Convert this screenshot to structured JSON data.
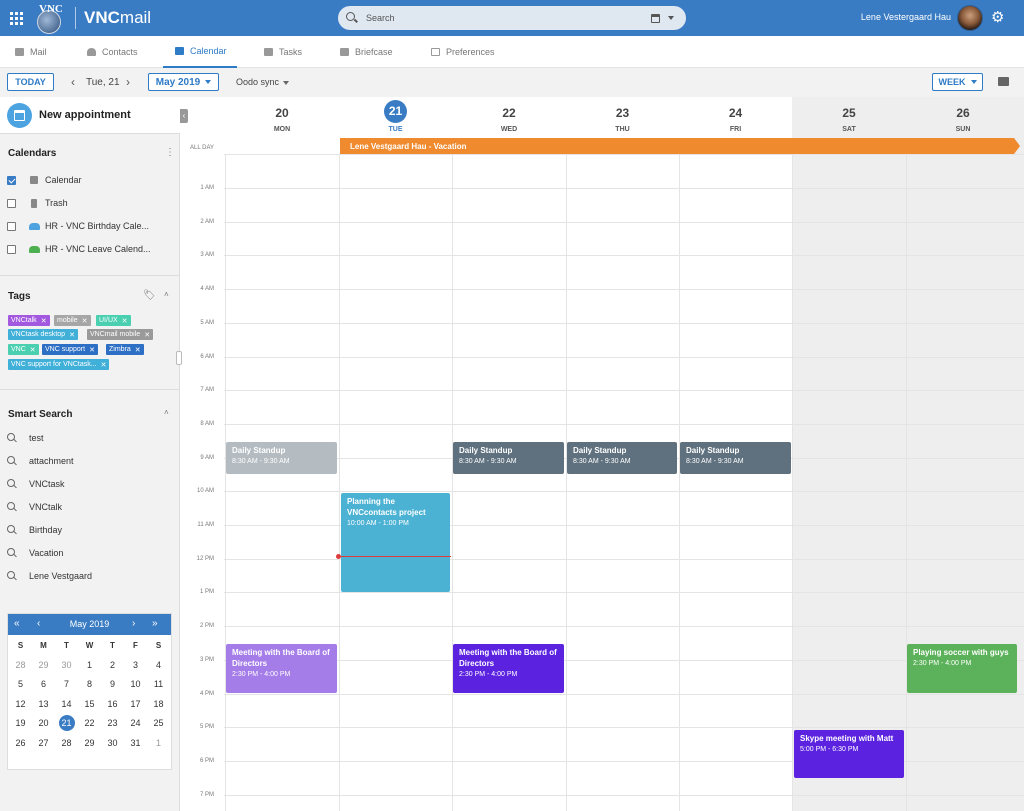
{
  "app": {
    "brand_prefix": "VNC",
    "brand_suffix": "mail",
    "logo_text": "VNC"
  },
  "search": {
    "placeholder": "Search"
  },
  "user": {
    "name": "Lene Vestergaard Hau"
  },
  "tabs": [
    {
      "label": "Mail"
    },
    {
      "label": "Contacts"
    },
    {
      "label": "Calendar",
      "active": true
    },
    {
      "label": "Tasks"
    },
    {
      "label": "Briefcase"
    },
    {
      "label": "Preferences"
    }
  ],
  "toolbar": {
    "today": "TODAY",
    "prev": "‹",
    "date": "Tue, 21",
    "next": "›",
    "month": "May 2019",
    "sync": "Oodo sync",
    "view": "WEEK"
  },
  "sidebar": {
    "new_appointment": "New appointment",
    "calendars_title": "Calendars",
    "calendars": [
      {
        "label": "Calendar",
        "checked": true
      },
      {
        "label": "Trash",
        "checked": false
      },
      {
        "label": "HR - VNC Birthday Cale...",
        "checked": false
      },
      {
        "label": "HR - VNC Leave Calend...",
        "checked": false
      }
    ],
    "tags_title": "Tags",
    "tags": [
      {
        "label": "VNCtalk",
        "color": "#a259e0"
      },
      {
        "label": "mobile",
        "color": "#a6a6a6"
      },
      {
        "label": "UI/UX",
        "color": "#4ad0b0"
      },
      {
        "label": "VNCtask desktop",
        "color": "#41b0d8"
      },
      {
        "label": "VNCmail mobile",
        "color": "#9a9a9a"
      },
      {
        "label": "VNC",
        "color": "#4ad0b0"
      },
      {
        "label": "VNC support",
        "color": "#2e6fc6"
      },
      {
        "label": "Zimbra",
        "color": "#2e6fc6"
      },
      {
        "label": "VNC support for VNCtask...",
        "color": "#41b0d8"
      }
    ],
    "smart_search_title": "Smart Search",
    "smart_searches": [
      "test",
      "attachment",
      "VNCtask",
      "VNCtalk",
      "Birthday",
      "Vacation",
      "Lene Vestgaard"
    ]
  },
  "minical": {
    "title": "May 2019",
    "weekdays": [
      "S",
      "M",
      "T",
      "W",
      "T",
      "F",
      "S"
    ],
    "weeks": [
      [
        "28",
        "29",
        "30",
        "1",
        "2",
        "3",
        "4"
      ],
      [
        "5",
        "6",
        "7",
        "8",
        "9",
        "10",
        "11"
      ],
      [
        "12",
        "13",
        "14",
        "15",
        "16",
        "17",
        "18"
      ],
      [
        "19",
        "20",
        "21",
        "22",
        "23",
        "24",
        "25"
      ],
      [
        "26",
        "27",
        "28",
        "29",
        "30",
        "31",
        "1"
      ]
    ],
    "selected": "21"
  },
  "week": {
    "days": [
      {
        "num": "20",
        "dow": "MON"
      },
      {
        "num": "21",
        "dow": "TUE",
        "today": true
      },
      {
        "num": "22",
        "dow": "WED"
      },
      {
        "num": "23",
        "dow": "THU"
      },
      {
        "num": "24",
        "dow": "FRI"
      },
      {
        "num": "25",
        "dow": "SAT",
        "weekend": true
      },
      {
        "num": "26",
        "dow": "SUN",
        "weekend": true
      }
    ],
    "all_day_label": "ALL DAY",
    "all_day_event": "Lene Vestgaard Hau - Vacation",
    "hours": [
      "1 AM",
      "2 AM",
      "3 AM",
      "4 AM",
      "5 AM",
      "6 AM",
      "7 AM",
      "8 AM",
      "9 AM",
      "10 AM",
      "11 AM",
      "12 PM",
      "1 PM",
      "2 PM",
      "3 PM",
      "4 PM",
      "5 PM",
      "6 PM",
      "7 PM"
    ],
    "events": [
      {
        "title": "Daily Standup",
        "time": "8:30 AM - 9:30 AM",
        "color": "#b4bcc2"
      },
      {
        "title": "Daily Standup",
        "time": "8:30 AM - 9:30 AM",
        "color": "#5f717f"
      },
      {
        "title": "Daily Standup",
        "time": "8:30 AM - 9:30 AM",
        "color": "#5f717f"
      },
      {
        "title": "Daily Standup",
        "time": "8:30 AM - 9:30 AM",
        "color": "#5f717f"
      },
      {
        "title": "Planning the VNCcontacts project",
        "time": "10:00 AM - 1:00 PM",
        "color": "#4cb2d4"
      },
      {
        "title": "Meeting with the Board of Directors",
        "time": "2:30 PM - 4:00 PM",
        "color": "#a57de8"
      },
      {
        "title": "Meeting with the Board of Directors",
        "time": "2:30 PM - 4:00 PM",
        "color": "#5b22e0"
      },
      {
        "title": "Playing soccer with guys",
        "time": "2:30 PM - 4:00 PM",
        "color": "#5cb25a"
      },
      {
        "title": "Skype meeting with Matt",
        "time": "5:00 PM - 6:30 PM",
        "color": "#5b22e0"
      }
    ]
  },
  "colors": {
    "primary": "#3a7cc4",
    "vacation": "#ef8a2e",
    "now_line": "#e03b3b"
  }
}
